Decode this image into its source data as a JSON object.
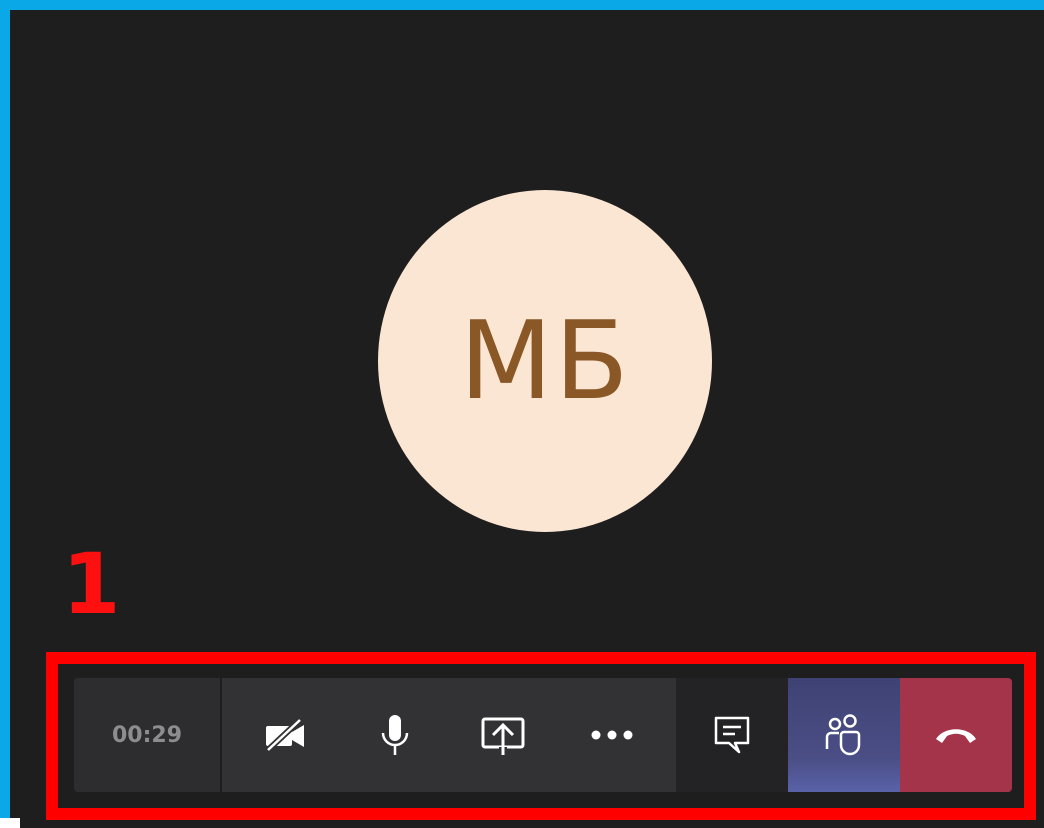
{
  "participant": {
    "initials": "МБ"
  },
  "annotation": {
    "step_number": "1"
  },
  "toolbar": {
    "timer": "00:29",
    "icons": {
      "camera": "video-off-icon",
      "mic": "microphone-icon",
      "share": "share-screen-icon",
      "more": "more-options-icon",
      "chat": "chat-icon",
      "participants": "participants-icon",
      "hangup": "hang-up-icon"
    }
  },
  "colors": {
    "frame_border": "#0aa8e6",
    "stage_bg": "#1e1e1e",
    "avatar_bg": "#fbe6d3",
    "avatar_text": "#8a5726",
    "highlight": "#ff0000",
    "participants_bg": "#444880",
    "hangup_bg": "#a4344a"
  }
}
